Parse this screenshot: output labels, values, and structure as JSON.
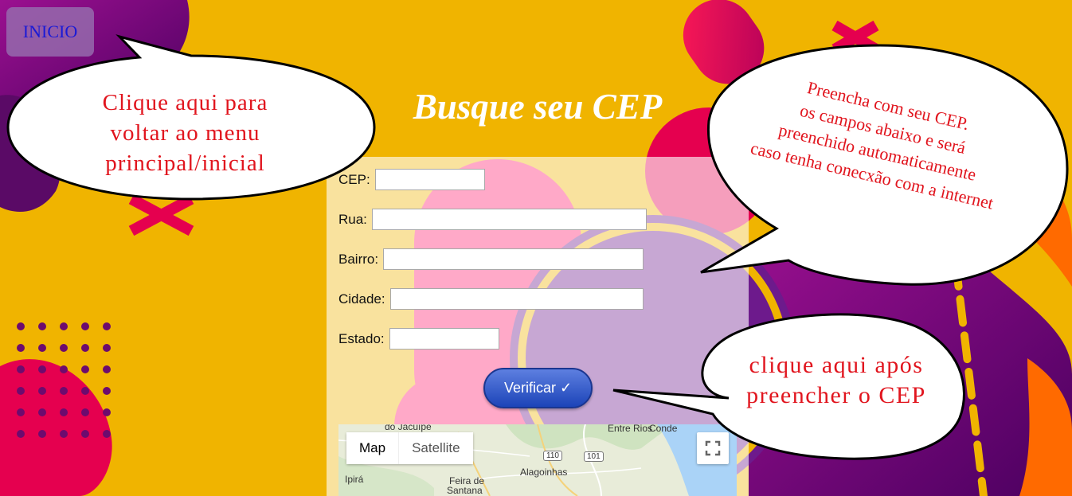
{
  "nav": {
    "home_label": "INICIO"
  },
  "header": {
    "title": "Busque seu CEP"
  },
  "form": {
    "cep_label": "CEP:",
    "rua_label": "Rua:",
    "bairro_label": "Bairro:",
    "cidade_label": "Cidade:",
    "estado_label": "Estado:",
    "cep_value": "",
    "rua_value": "",
    "bairro_value": "",
    "cidade_value": "",
    "estado_value": "",
    "verify_label": "Verificar ✓"
  },
  "map": {
    "map_label": "Map",
    "satellite_label": "Satellite",
    "fullscreen_icon": "fullscreen-icon",
    "places": [
      "do Jacuípe",
      "Conde",
      "Alagoinhas",
      "Feira de",
      "Santana",
      "Ipirá",
      "Entre Rios"
    ],
    "roads": [
      "110",
      "101"
    ]
  },
  "callouts": {
    "home_hint": [
      "Clique aqui para",
      "voltar ao menu",
      "principal/inicial"
    ],
    "fill_hint": [
      "Preencha com seu CEP.",
      "os campos abaixo e será",
      "preenchido automaticamente",
      "caso tenha conecxão com a internet"
    ],
    "verify_hint": [
      "clique aqui após",
      "preencher o CEP"
    ]
  },
  "colors": {
    "background": "#f0b400",
    "magenta": "#e5004f",
    "purple": "#6d0b6e",
    "callout_text": "#e1151e",
    "home_link_text": "#1a1ad6",
    "verify_button": "#2a55c8"
  }
}
